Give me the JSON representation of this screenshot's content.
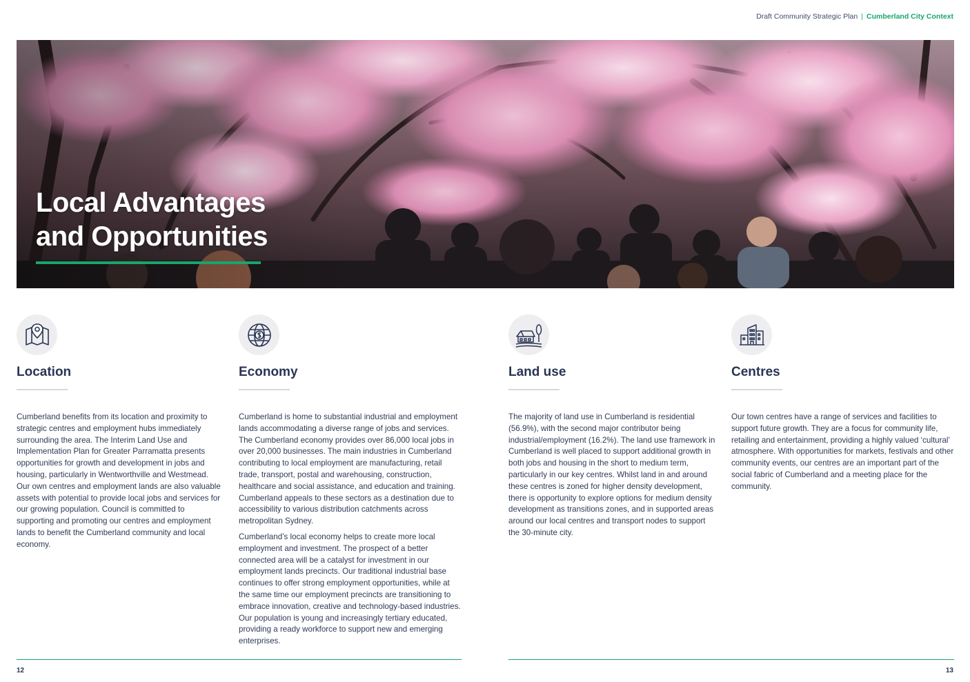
{
  "header": {
    "doc_title": "Draft Community Strategic Plan",
    "separator": "|",
    "section": "Cumberland City Context"
  },
  "hero": {
    "title_line1": "Local Advantages",
    "title_line2": "and Opportunities",
    "accent_color": "#18a66b"
  },
  "columns": [
    {
      "icon": "map-location-icon",
      "heading": "Location",
      "paragraphs": [
        "Cumberland benefits from its location and proximity to strategic centres and employment hubs immediately surrounding the area. The Interim Land Use and Implementation Plan for Greater Parramatta presents opportunities for growth and development in jobs and housing, particularly in Wentworthville and Westmead. Our own centres and employment lands are also valuable assets with potential to provide local jobs and services for our growing population. Council is committed to supporting and promoting our centres and employment lands to benefit the Cumberland community and local economy."
      ]
    },
    {
      "icon": "globe-dollar-icon",
      "heading": "Economy",
      "paragraphs": [
        "Cumberland is home to substantial industrial and employment lands accommodating a diverse range of jobs and services. The Cumberland economy provides over 86,000 local jobs in over 20,000 businesses. The main industries in Cumberland contributing to local employment are manufacturing, retail trade, transport, postal and warehousing, construction, healthcare and social assistance, and education and training. Cumberland appeals to these sectors as a destination due to accessibility to various distribution catchments across metropolitan Sydney.",
        "Cumberland’s local economy helps to create more local employment and investment. The prospect of a better connected area will be a catalyst for investment in our employment lands precincts. Our traditional industrial base continues to offer strong employment opportunities, while at the same time our employment precincts are transitioning to embrace innovation, creative and technology-based industries. Our population is young and increasingly tertiary educated, providing a ready workforce to support new and emerging enterprises."
      ]
    },
    {
      "icon": "farmhouse-icon",
      "heading": "Land use",
      "paragraphs": [
        "The majority of land use in Cumberland is residential (56.9%), with the second major contributor being industrial/employment (16.2%). The land use framework in Cumberland is well placed to support additional growth in both jobs and housing in the short to medium term, particularly in our key centres. Whilst land in and around these centres is zoned for higher density development, there is opportunity to explore options for medium density development as transitions zones, and in supported areas around our local centres and transport nodes to support the 30-minute city."
      ]
    },
    {
      "icon": "city-buildings-icon",
      "heading": "Centres",
      "paragraphs": [
        "Our town centres have a range of services and facilities to support future growth. They are a focus for community life, retailing and entertainment, providing a highly valued ‘cultural’ atmosphere. With opportunities for markets, festivals and other community events, our centres are an important part of the social fabric of Cumberland and a meeting place for the community."
      ]
    }
  ],
  "footer": {
    "page_left": "12",
    "page_right": "13"
  }
}
